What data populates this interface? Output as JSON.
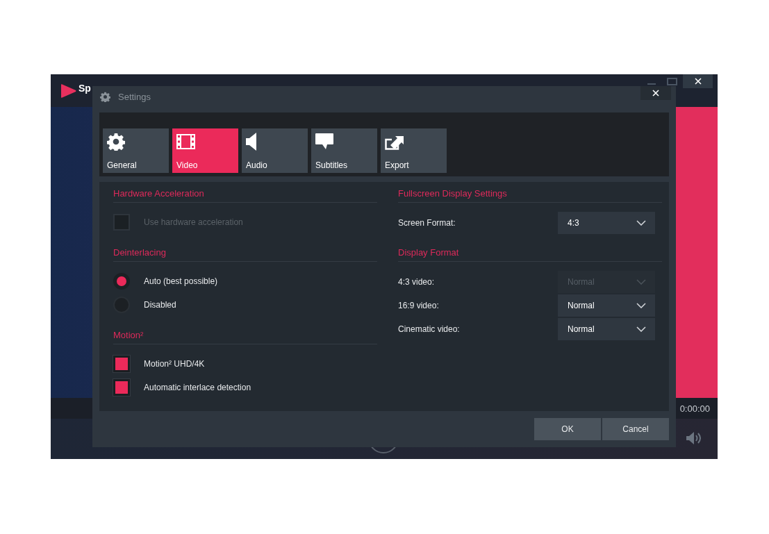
{
  "app": {
    "name": "Sp",
    "time": "0:00:00"
  },
  "dialog": {
    "title": "Settings",
    "tabs": [
      {
        "label": "General",
        "selected": false
      },
      {
        "label": "Video",
        "selected": true
      },
      {
        "label": "Audio",
        "selected": false
      },
      {
        "label": "Subtitles",
        "selected": false
      },
      {
        "label": "Export",
        "selected": false
      }
    ],
    "left_sections": [
      {
        "title": "Hardware Acceleration",
        "items": [
          {
            "kind": "checkbox",
            "label": "Use hardware acceleration",
            "checked": false,
            "disabled": true
          }
        ]
      },
      {
        "title": "Deinterlacing",
        "items": [
          {
            "kind": "radio",
            "label": "Auto (best possible)",
            "selected": true
          },
          {
            "kind": "radio",
            "label": "Disabled",
            "selected": false
          }
        ]
      },
      {
        "title": "Motion²",
        "items": [
          {
            "kind": "checkbox",
            "label": "Motion²  UHD/4K",
            "checked": true,
            "disabled": false
          },
          {
            "kind": "checkbox",
            "label": "Automatic interlace detection",
            "checked": true,
            "disabled": false
          }
        ]
      }
    ],
    "right_sections": [
      {
        "title": "Fullscreen Display Settings",
        "items": [
          {
            "kind": "select",
            "label": "Screen Format:",
            "value": "4:3",
            "disabled": false
          }
        ]
      },
      {
        "title": "Display Format",
        "items": [
          {
            "kind": "select",
            "label": "4:3 video:",
            "value": "Normal",
            "disabled": true
          },
          {
            "kind": "select",
            "label": "16:9 video:",
            "value": "Normal",
            "disabled": false
          },
          {
            "kind": "select",
            "label": "Cinematic video:",
            "value": "Normal",
            "disabled": false
          }
        ]
      }
    ],
    "buttons": [
      "OK",
      "Cancel"
    ]
  }
}
